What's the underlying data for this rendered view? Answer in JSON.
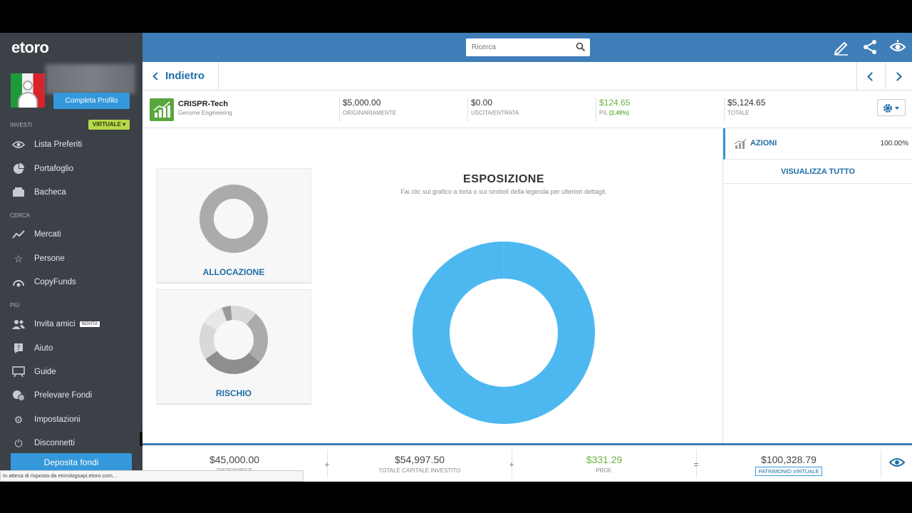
{
  "brand": "etoro",
  "sidebar": {
    "profile_button": "Completa Profilo",
    "section_invest": "INVESTI",
    "mode_badge": "VIRTUALE",
    "section_search": "CERCA",
    "section_more": "PIÙ",
    "items": [
      {
        "label": "Lista Preferiti",
        "icon": "eye-icon"
      },
      {
        "label": "Portafoglio",
        "icon": "pie-icon"
      },
      {
        "label": "Bacheca",
        "icon": "newsfeed-icon"
      },
      {
        "label": "Mercati",
        "icon": "trend-icon"
      },
      {
        "label": "Persone",
        "icon": "star-icon"
      },
      {
        "label": "CopyFunds",
        "icon": "copyfunds-icon"
      },
      {
        "label": "Invita amici",
        "icon": "users-icon",
        "badge": "NOVITÀ"
      },
      {
        "label": "Aiuto",
        "icon": "help-icon"
      },
      {
        "label": "Guide",
        "icon": "guide-icon"
      },
      {
        "label": "Prelevare Fondi",
        "icon": "withdraw-icon"
      },
      {
        "label": "Impostazioni",
        "icon": "gear-icon"
      },
      {
        "label": "Disconnetti",
        "icon": "logout-icon"
      }
    ],
    "deposit_button": "Deposita fondi"
  },
  "topbar": {
    "search_placeholder": "Ricerca"
  },
  "header": {
    "back_label": "Indietro"
  },
  "position": {
    "name": "CRISPR-Tech",
    "subtitle": "Genome Engineering",
    "invested": {
      "value": "$5,000.00",
      "label": "ORIGINARIAMENTE"
    },
    "cashflow": {
      "value": "$0.00",
      "label": "USCITA/ENTRATA"
    },
    "pl": {
      "value": "$124.65",
      "label": "P/L",
      "pct": "(2.49%)"
    },
    "total": {
      "value": "$5,124.65",
      "label": "TOTALE"
    }
  },
  "cards": {
    "allocation": "ALLOCAZIONE",
    "risk": "RISCHIO"
  },
  "exposure": {
    "title": "ESPOSIZIONE",
    "subtitle": "Fai clic sul grafico a torta o sui simboli della legenda per ulteriori dettagli."
  },
  "right_panel": {
    "category": "AZIONI",
    "percent": "100.00%",
    "view_all": "VISUALIZZA TUTTO"
  },
  "bottom": {
    "available": {
      "value": "$45,000.00",
      "label": "DISPONIBILE"
    },
    "invested": {
      "value": "$54,997.50",
      "label": "TOTALE CAPITALE INVESTITO"
    },
    "profit": {
      "value": "$331.29",
      "label": "PROF."
    },
    "equity": {
      "value": "$100,328.79",
      "label": "PATRIMONIO VIRTUALE"
    },
    "op_plus_1": "+",
    "op_plus_2": "+",
    "op_eq": "="
  },
  "status_text": "In attesa di risposta da etorologsapi.etoro.com...",
  "colors": {
    "accent": "#3498db",
    "topbar": "#3f7eb8",
    "sidebar": "#3c4148",
    "positive": "#6db33f",
    "donut": "#4db8f0"
  }
}
